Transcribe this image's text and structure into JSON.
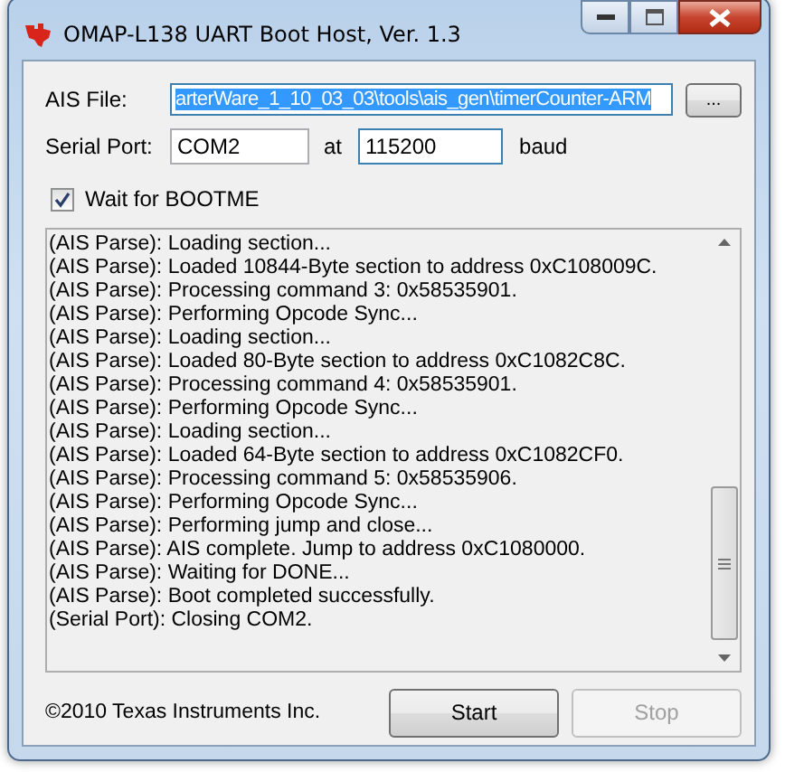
{
  "window": {
    "title": "OMAP-L138 UART Boot Host, Ver. 1.3"
  },
  "ais_file": {
    "label": "AIS File:",
    "value": "arterWare_1_10_03_03\\tools\\ais_gen\\timerCounter-ARM",
    "selected": true,
    "browse": "..."
  },
  "serial_port": {
    "label": "Serial Port:",
    "value": "COM2",
    "at": "at",
    "baud": "115200",
    "baud_unit": "baud"
  },
  "wait_for_bootme": {
    "label": "Wait for BOOTME",
    "checked": true
  },
  "log": [
    "(AIS Parse): Loading section...",
    "(AIS Parse): Loaded 10844-Byte section to address 0xC108009C.",
    "(AIS Parse): Processing command 3: 0x58535901.",
    "(AIS Parse): Performing Opcode Sync...",
    "(AIS Parse): Loading section...",
    "(AIS Parse): Loaded 80-Byte section to address 0xC1082C8C.",
    "(AIS Parse): Processing command 4: 0x58535901.",
    "(AIS Parse): Performing Opcode Sync...",
    "(AIS Parse): Loading section...",
    "(AIS Parse): Loaded 64-Byte section to address 0xC1082CF0.",
    "(AIS Parse): Processing command 5: 0x58535906.",
    "(AIS Parse): Performing Opcode Sync...",
    "(AIS Parse): Performing jump and close...",
    "(AIS Parse): AIS complete. Jump to address 0xC1080000.",
    "(AIS Parse): Waiting for DONE...",
    "(AIS Parse): Boot completed successfully.",
    "(Serial Port): Closing COM2."
  ],
  "copyright": "©2010 Texas Instruments Inc.",
  "buttons": [
    {
      "label": "Start",
      "disabled": false
    },
    {
      "label": "Stop",
      "disabled": true
    }
  ]
}
